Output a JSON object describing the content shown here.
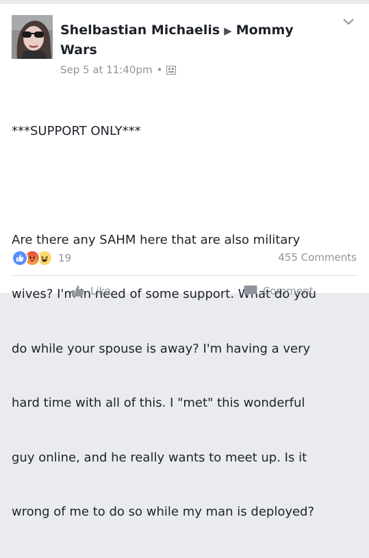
{
  "post": {
    "author": "Shelbastian Michaelis",
    "group": "Mommy Wars",
    "timestamp": "Sep 5 at 11:40pm",
    "privacy_icon": "group-privacy-icon",
    "text_lines": [
      "***SUPPORT ONLY***",
      "",
      "Are there any SAHM here that are also military",
      "wives? I'm in need of some support. What do you",
      "do while your spouse is away? I'm having a very",
      "hard time with all of this. I \"met\" this wonderful",
      "guy online, and he really wants to meet up. Is it",
      "wrong of me to do so while my man is deployed?"
    ]
  },
  "reactions": {
    "icons": [
      "like-reaction-icon",
      "angry-reaction-icon",
      "haha-reaction-icon"
    ],
    "count": "19",
    "colors": {
      "like": "#5890ff",
      "angry": "#f7714b",
      "haha": "#fcd669"
    }
  },
  "comments": {
    "count_label": "455 Comments"
  },
  "actions": {
    "like_label": "Like",
    "comment_label": "Comment"
  }
}
